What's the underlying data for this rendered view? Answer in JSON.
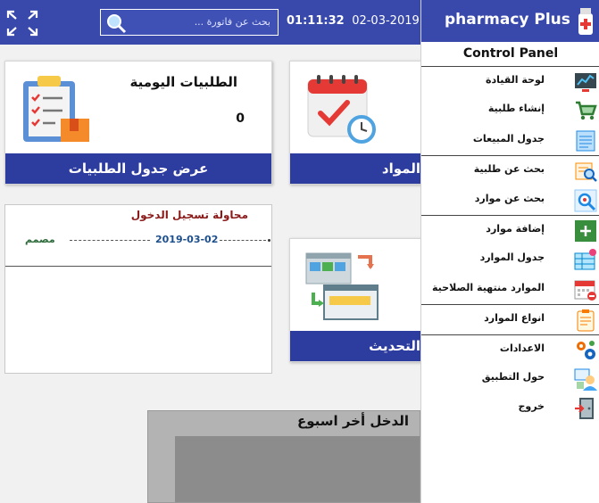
{
  "header": {
    "search_placeholder": "بحث عن فاتورة ...",
    "time": "01:11:32",
    "date": "02-03-2019"
  },
  "cards": {
    "daily_orders": {
      "title": "الطلبيات اليومية",
      "count": "0",
      "footer": "عرض جدول الطلبيات"
    },
    "materials": {
      "footer": "المواد"
    },
    "update": {
      "footer": "التحديث"
    }
  },
  "login_log": {
    "title": "محاولة تسجيل الدخول",
    "date": "2019-03-02",
    "status": "مصمم"
  },
  "income": {
    "title": "الدخل أخر اسبوع"
  },
  "sidebar": {
    "brand": "pharmacy Plus",
    "section": "Control Panel",
    "items": [
      {
        "label": "لوحة القيادة",
        "icon": "dashboard-icon"
      },
      {
        "label": "إنشاء طلبية",
        "icon": "cart-icon"
      },
      {
        "label": "جدول المبيعات",
        "icon": "sales-table-icon"
      },
      {
        "label": "بحث عن طلبية",
        "icon": "order-search-icon"
      },
      {
        "label": "بحث عن موارد",
        "icon": "resource-search-icon"
      },
      {
        "label": "إضافة موارد",
        "icon": "add-resource-icon"
      },
      {
        "label": "جدول الموارد",
        "icon": "resource-table-icon"
      },
      {
        "label": "الموارد منتهية الصلاحية",
        "icon": "expired-calendar-icon"
      },
      {
        "label": "انواع الموارد",
        "icon": "clipboard-icon"
      },
      {
        "label": "الاعدادات",
        "icon": "gears-icon"
      },
      {
        "label": "حول التطبيق",
        "icon": "about-icon"
      },
      {
        "label": "خروج",
        "icon": "exit-door-icon"
      }
    ]
  },
  "colors": {
    "primary": "#3949ab",
    "card_footer": "#2d3c9f",
    "login_title": "#8b1a1a"
  }
}
